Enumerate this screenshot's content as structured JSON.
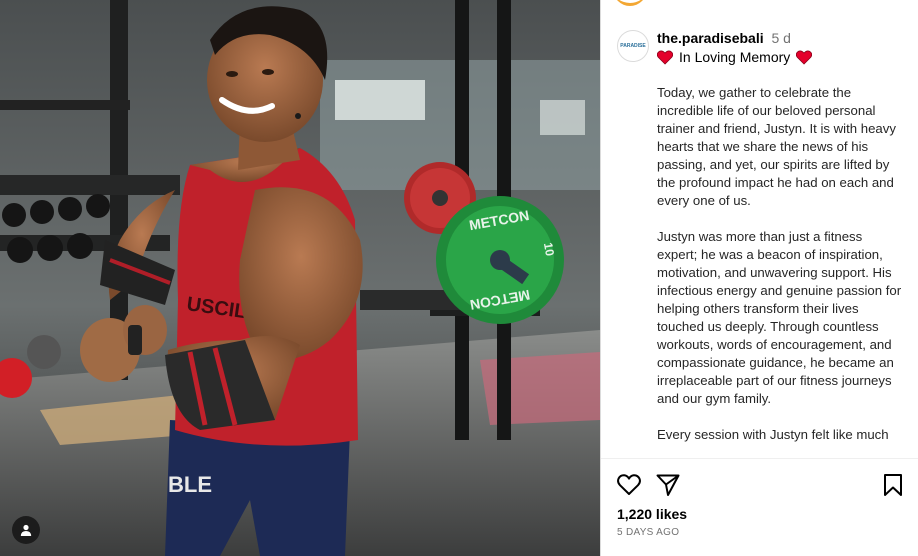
{
  "post": {
    "username": "the.paradisebali",
    "time_ago": "5 d",
    "avatar_text": "PARADISE",
    "memory_line": "In Loving Memory",
    "paragraphs": [
      "Today, we gather to celebrate the incredible life of our beloved personal trainer and friend, Justyn. It is with heavy hearts that we share the news of his passing, and yet, our spirits are lifted by the profound impact he had on each and every one of us.",
      "Justyn was more than just a fitness expert; he was a beacon of inspiration, motivation, and unwavering support. His infectious energy and genuine passion for helping others transform their lives touched us deeply. Through countless workouts, words of encouragement, and compassionate guidance, he became an irreplaceable part of our fitness journeys and our gym family.",
      "Every session with Justyn felt like much"
    ],
    "likes": "1,220 likes",
    "date": "5 DAYS AGO"
  },
  "photo": {
    "shirt_text": "USCIL",
    "shorts_text": "BLE",
    "plate_text_top": "METCON",
    "plate_text_bottom": "METCON",
    "plate_weight": "10"
  },
  "icons": {
    "like": "heart-outline-icon",
    "share": "send-icon",
    "save": "bookmark-icon",
    "tag": "user-tag-icon",
    "memory": "red-heart-emoji-icon"
  },
  "colors": {
    "heart_red": "#e4002b",
    "story_ring": "#f3a733",
    "text_secondary": "#737373"
  }
}
